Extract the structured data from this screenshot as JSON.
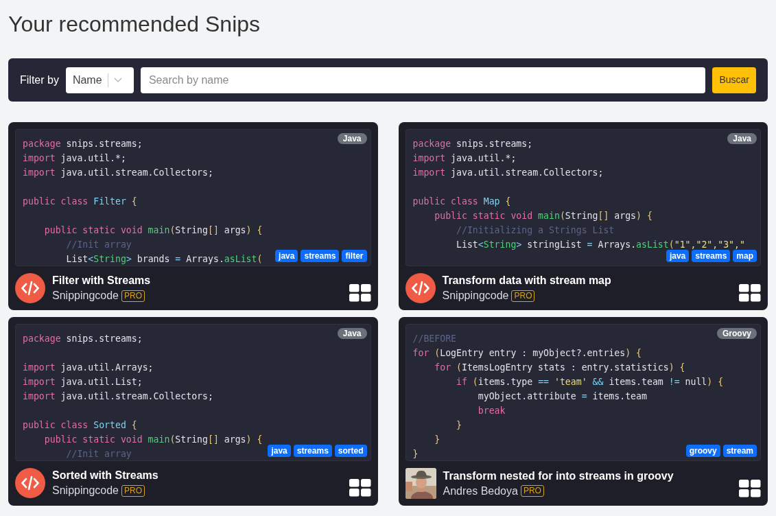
{
  "page_title": "Your recommended Snips",
  "filter_bar": {
    "label": "Filter by",
    "select": {
      "value": "Name"
    },
    "search": {
      "placeholder": "Search by name"
    },
    "button": "Buscar"
  },
  "cards": [
    {
      "language": "Java",
      "avatar": {
        "kind": "logo"
      },
      "title": "Filter with Streams",
      "author": "Snippingcode",
      "badge": "PRO",
      "tags": [
        "java",
        "streams",
        "filter"
      ],
      "code": [
        {
          "tokens": [
            {
              "kind": "keyword",
              "text": "package"
            },
            {
              "kind": "plain",
              "text": " snips.streams;"
            }
          ]
        },
        {
          "tokens": [
            {
              "kind": "keyword",
              "text": "import"
            },
            {
              "kind": "plain",
              "text": " java.util.*;"
            }
          ]
        },
        {
          "tokens": [
            {
              "kind": "keyword",
              "text": "import"
            },
            {
              "kind": "plain",
              "text": " java.util.stream.Collectors;"
            }
          ]
        },
        {
          "kind": "blank"
        },
        {
          "tokens": [
            {
              "kind": "keyword",
              "text": "public class"
            },
            {
              "kind": "type",
              "text": " Filter"
            },
            {
              "kind": "brace",
              "text": " {"
            }
          ]
        },
        {
          "kind": "blank"
        },
        {
          "tokens": [
            {
              "kind": "keyword",
              "text": "    public static void"
            },
            {
              "kind": "func",
              "text": " main"
            },
            {
              "kind": "brace",
              "text": "("
            },
            {
              "kind": "plain",
              "text": "String"
            },
            {
              "kind": "brace",
              "text": "[]"
            },
            {
              "kind": "plain",
              "text": " args"
            },
            {
              "kind": "brace",
              "text": ") {"
            }
          ]
        },
        {
          "tokens": [
            {
              "kind": "comment",
              "text": "        //Init array"
            }
          ]
        },
        {
          "tokens": [
            {
              "kind": "plain",
              "text": "        List"
            },
            {
              "kind": "op",
              "text": "<"
            },
            {
              "kind": "func",
              "text": "String"
            },
            {
              "kind": "op",
              "text": ">"
            },
            {
              "kind": "plain",
              "text": " brands "
            },
            {
              "kind": "op",
              "text": "="
            },
            {
              "kind": "plain",
              "text": " Arrays."
            },
            {
              "kind": "func",
              "text": "asList"
            },
            {
              "kind": "brace",
              "text": "("
            }
          ]
        }
      ]
    },
    {
      "language": "Java",
      "avatar": {
        "kind": "logo"
      },
      "title": "Transform data with stream map",
      "author": "Snippingcode",
      "badge": "PRO",
      "tags": [
        "java",
        "streams",
        "map"
      ],
      "code": [
        {
          "tokens": [
            {
              "kind": "keyword",
              "text": "package"
            },
            {
              "kind": "plain",
              "text": " snips.streams;"
            }
          ]
        },
        {
          "tokens": [
            {
              "kind": "keyword",
              "text": "import"
            },
            {
              "kind": "plain",
              "text": " java.util.*;"
            }
          ]
        },
        {
          "tokens": [
            {
              "kind": "keyword",
              "text": "import"
            },
            {
              "kind": "plain",
              "text": " java.util.stream.Collectors;"
            }
          ]
        },
        {
          "kind": "blank"
        },
        {
          "tokens": [
            {
              "kind": "keyword",
              "text": "public class"
            },
            {
              "kind": "type",
              "text": " Map"
            },
            {
              "kind": "brace",
              "text": " {"
            }
          ]
        },
        {
          "tokens": [
            {
              "kind": "keyword",
              "text": "    public static void"
            },
            {
              "kind": "func",
              "text": " main"
            },
            {
              "kind": "brace",
              "text": "("
            },
            {
              "kind": "plain",
              "text": "String"
            },
            {
              "kind": "brace",
              "text": "[]"
            },
            {
              "kind": "plain",
              "text": " args"
            },
            {
              "kind": "brace",
              "text": ") {"
            }
          ]
        },
        {
          "tokens": [
            {
              "kind": "comment",
              "text": "        //Initializing a Strings List"
            }
          ]
        },
        {
          "tokens": [
            {
              "kind": "plain",
              "text": "        List"
            },
            {
              "kind": "op",
              "text": "<"
            },
            {
              "kind": "func",
              "text": "String"
            },
            {
              "kind": "op",
              "text": ">"
            },
            {
              "kind": "plain",
              "text": " stringList "
            },
            {
              "kind": "op",
              "text": "="
            },
            {
              "kind": "plain",
              "text": " Arrays."
            },
            {
              "kind": "func",
              "text": "asList"
            },
            {
              "kind": "brace",
              "text": "("
            },
            {
              "kind": "string",
              "text": "\"1\",\"2\",\"3\",\""
            }
          ]
        }
      ]
    },
    {
      "language": "Java",
      "avatar": {
        "kind": "logo"
      },
      "title": "Sorted with Streams",
      "author": "Snippingcode",
      "badge": "PRO",
      "tags": [
        "java",
        "streams",
        "sorted"
      ],
      "code": [
        {
          "tokens": [
            {
              "kind": "keyword",
              "text": "package"
            },
            {
              "kind": "plain",
              "text": " snips.streams;"
            }
          ]
        },
        {
          "kind": "blank"
        },
        {
          "tokens": [
            {
              "kind": "keyword",
              "text": "import"
            },
            {
              "kind": "plain",
              "text": " java.util.Arrays;"
            }
          ]
        },
        {
          "tokens": [
            {
              "kind": "keyword",
              "text": "import"
            },
            {
              "kind": "plain",
              "text": " java.util.List;"
            }
          ]
        },
        {
          "tokens": [
            {
              "kind": "keyword",
              "text": "import"
            },
            {
              "kind": "plain",
              "text": " java.util.stream.Collectors;"
            }
          ]
        },
        {
          "kind": "blank"
        },
        {
          "tokens": [
            {
              "kind": "keyword",
              "text": "public class"
            },
            {
              "kind": "type",
              "text": " Sorted"
            },
            {
              "kind": "brace",
              "text": " {"
            }
          ]
        },
        {
          "tokens": [
            {
              "kind": "keyword",
              "text": "    public static void"
            },
            {
              "kind": "func",
              "text": " main"
            },
            {
              "kind": "brace",
              "text": "("
            },
            {
              "kind": "plain",
              "text": "String"
            },
            {
              "kind": "brace",
              "text": "[]"
            },
            {
              "kind": "plain",
              "text": " args"
            },
            {
              "kind": "brace",
              "text": ") {"
            }
          ]
        },
        {
          "tokens": [
            {
              "kind": "comment",
              "text": "        //Init array"
            }
          ]
        }
      ]
    },
    {
      "language": "Groovy",
      "avatar": {
        "kind": "picture"
      },
      "title": "Transform nested for into streams in groovy",
      "author": "Andres Bedoya",
      "badge": "PRO",
      "tags": [
        "groovy",
        "stream"
      ],
      "code": [
        {
          "tokens": [
            {
              "kind": "comment",
              "text": "//BEFORE"
            }
          ]
        },
        {
          "tokens": [
            {
              "kind": "keyword",
              "text": "for"
            },
            {
              "kind": "brace",
              "text": " ("
            },
            {
              "kind": "plain",
              "text": "LogEntry entry : myObject?.entries"
            },
            {
              "kind": "brace",
              "text": ") {"
            }
          ]
        },
        {
          "tokens": [
            {
              "kind": "keyword",
              "text": "    for"
            },
            {
              "kind": "brace",
              "text": " ("
            },
            {
              "kind": "plain",
              "text": "ItemsLogEntry stats : entry.statistics"
            },
            {
              "kind": "brace",
              "text": ") {"
            }
          ]
        },
        {
          "tokens": [
            {
              "kind": "keyword",
              "text": "        if"
            },
            {
              "kind": "brace",
              "text": " ("
            },
            {
              "kind": "plain",
              "text": "items.type "
            },
            {
              "kind": "op",
              "text": "=="
            },
            {
              "kind": "string",
              "text": " 'team'"
            },
            {
              "kind": "op",
              "text": " &&"
            },
            {
              "kind": "plain",
              "text": " items.team "
            },
            {
              "kind": "op",
              "text": "!="
            },
            {
              "kind": "plain",
              "text": " null"
            },
            {
              "kind": "brace",
              "text": ") {"
            }
          ]
        },
        {
          "tokens": [
            {
              "kind": "plain",
              "text": "            myObject.attribute "
            },
            {
              "kind": "op",
              "text": "="
            },
            {
              "kind": "plain",
              "text": " items.team"
            }
          ]
        },
        {
          "tokens": [
            {
              "kind": "keyword",
              "text": "            break"
            }
          ]
        },
        {
          "tokens": [
            {
              "kind": "brace",
              "text": "        }"
            }
          ]
        },
        {
          "tokens": [
            {
              "kind": "brace",
              "text": "    }"
            }
          ]
        },
        {
          "tokens": [
            {
              "kind": "brace",
              "text": "}"
            }
          ]
        }
      ]
    }
  ]
}
